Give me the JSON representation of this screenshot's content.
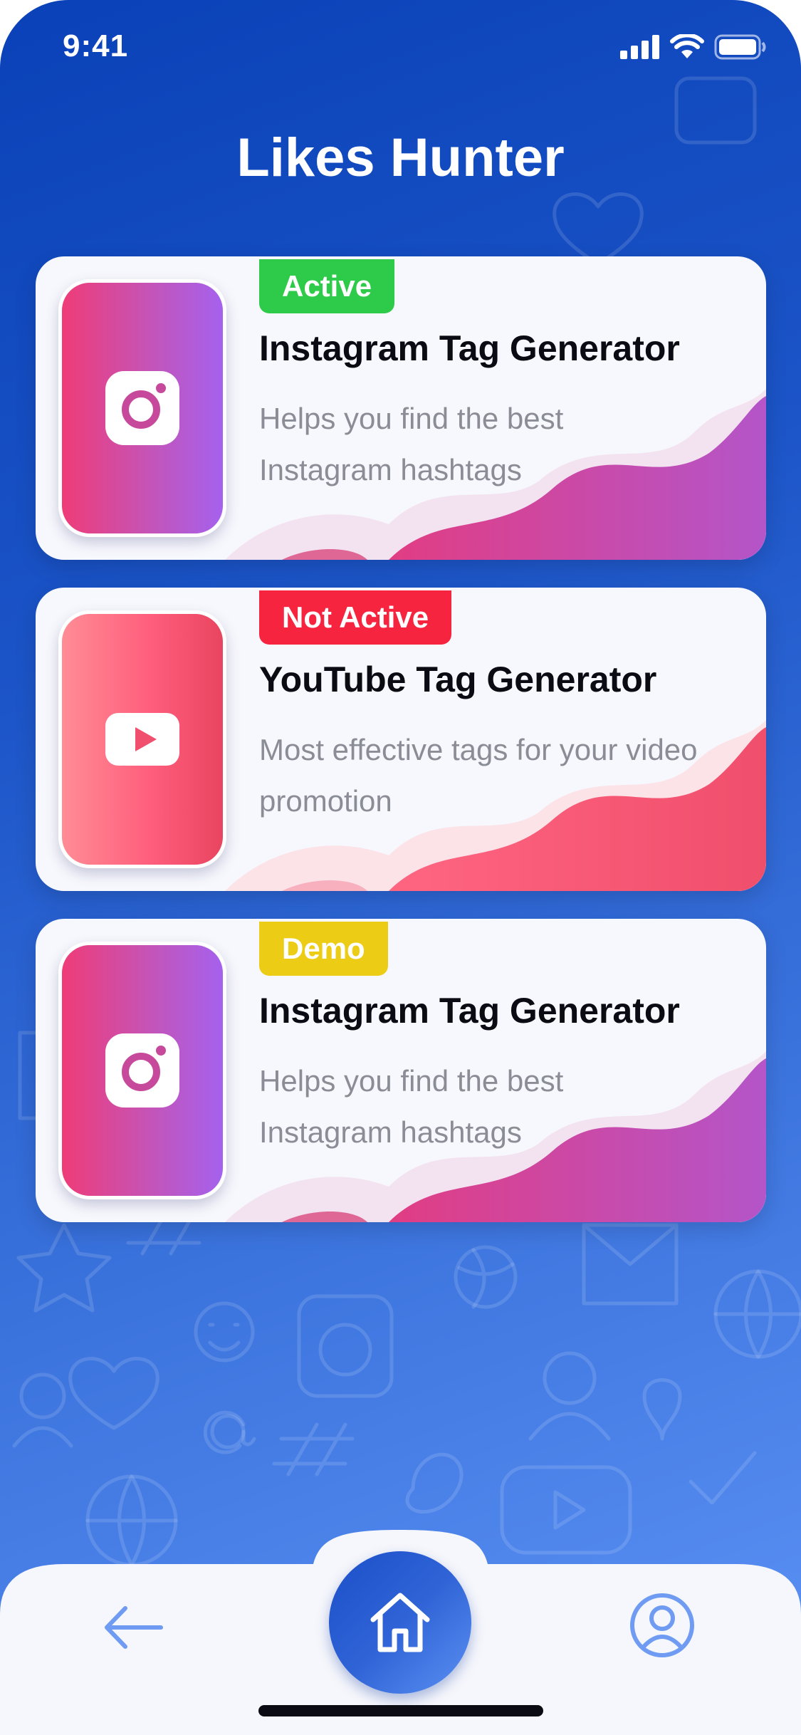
{
  "status_bar": {
    "time": "9:41"
  },
  "app": {
    "title": "Likes Hunter"
  },
  "cards": [
    {
      "badge": "Active",
      "title": "Instagram Tag Generator",
      "description": "Helps you find the best Instagram hashtags",
      "icon": "instagram-icon",
      "badge_color": "#2ecb4a"
    },
    {
      "badge": "Not Active",
      "title": "YouTube Tag Generator",
      "description": "Most effective tags for your video promotion",
      "icon": "youtube-icon",
      "badge_color": "#f7243f"
    },
    {
      "badge": "Demo",
      "title": "Instagram Tag Generator",
      "description": "Helps you find the best Instagram hashtags",
      "icon": "instagram-icon",
      "badge_color": "#edcc16"
    }
  ],
  "nav": {
    "back_icon": "arrow-left-icon",
    "home_icon": "home-icon",
    "profile_icon": "user-circle-icon"
  },
  "colors": {
    "background_start": "#0a41b8",
    "background_end": "#5d93f6",
    "instagram_gradient": [
      "#ef3c78",
      "#a561ee"
    ],
    "youtube_gradient": [
      "#ff8c95",
      "#e84560"
    ],
    "nav_icon": "#6f9cf2"
  }
}
